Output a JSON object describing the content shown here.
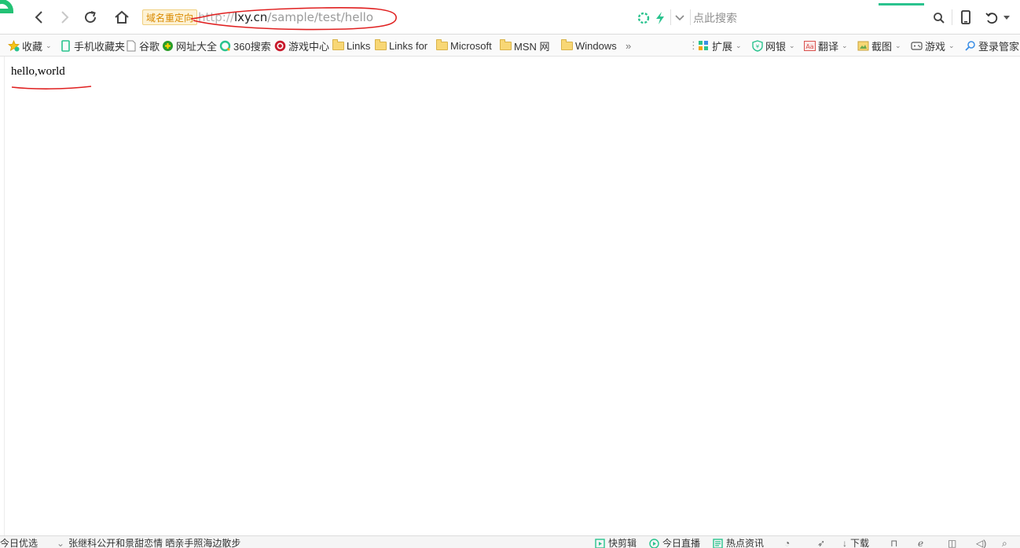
{
  "toolbar": {
    "redirect_badge": "域名重定向",
    "url": {
      "scheme": "http://",
      "host": "lxy.cn",
      "path": "/sample/test/hello"
    },
    "search_placeholder": "点此搜索"
  },
  "bookmarks": {
    "items": [
      {
        "label": "收藏",
        "icon": "star-icon"
      },
      {
        "label": "手机收藏夹",
        "icon": "phone-icon"
      },
      {
        "label": "谷歌",
        "icon": "page-icon"
      },
      {
        "label": "网址大全",
        "icon": "url-directory-icon"
      },
      {
        "label": "360搜索",
        "icon": "search-360-icon"
      },
      {
        "label": "游戏中心",
        "icon": "game-center-icon"
      },
      {
        "label": "Links",
        "icon": "folder-icon"
      },
      {
        "label": "Links for",
        "icon": "folder-icon"
      },
      {
        "label": "Microsoft",
        "icon": "folder-icon"
      },
      {
        "label": "MSN 网",
        "icon": "folder-icon"
      },
      {
        "label": "Windows",
        "icon": "folder-icon"
      }
    ],
    "overflow": "»",
    "right_items": [
      {
        "label": "扩展",
        "icon": "extensions-icon"
      },
      {
        "label": "网银",
        "icon": "bank-shield-icon"
      },
      {
        "label": "翻译",
        "icon": "translate-icon"
      },
      {
        "label": "截图",
        "icon": "screenshot-icon"
      },
      {
        "label": "游戏",
        "icon": "gamepad-icon"
      },
      {
        "label": "登录管家",
        "icon": "login-manager-icon"
      }
    ]
  },
  "page": {
    "body_text": "hello,world"
  },
  "statusbar": {
    "left_label": "今日优选",
    "news": "张继科公开和景甜恋情 晒亲手照海边散步",
    "right_items": [
      {
        "label": "快剪辑"
      },
      {
        "label": "今日直播"
      },
      {
        "label": "热点资讯"
      },
      {
        "label": "下载"
      }
    ]
  },
  "colors": {
    "accent_green": "#2ac38e",
    "annotation_red": "#e02020",
    "redirect_badge_bg": "#fdf2d5"
  }
}
